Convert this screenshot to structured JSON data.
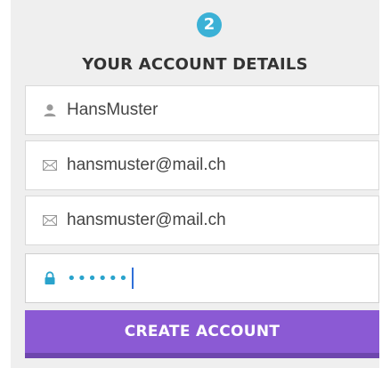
{
  "step": {
    "number": "2"
  },
  "heading": "YOUR ACCOUNT DETAILS",
  "fields": {
    "username": {
      "value": "HansMuster",
      "icon": "user-icon"
    },
    "email": {
      "value": "hansmuster@mail.ch",
      "icon": "envelope-icon"
    },
    "email_confirm": {
      "value": "hansmuster@mail.ch",
      "icon": "envelope-icon"
    },
    "password": {
      "masked_value": "••••••",
      "icon": "lock-icon"
    }
  },
  "create_button": {
    "label": "CREATE ACCOUNT"
  },
  "colors": {
    "panel_background": "#efefef",
    "step_badge": "#3bb1d6",
    "button": "#8b5ad4",
    "lock_icon": "#2aa3cc"
  }
}
